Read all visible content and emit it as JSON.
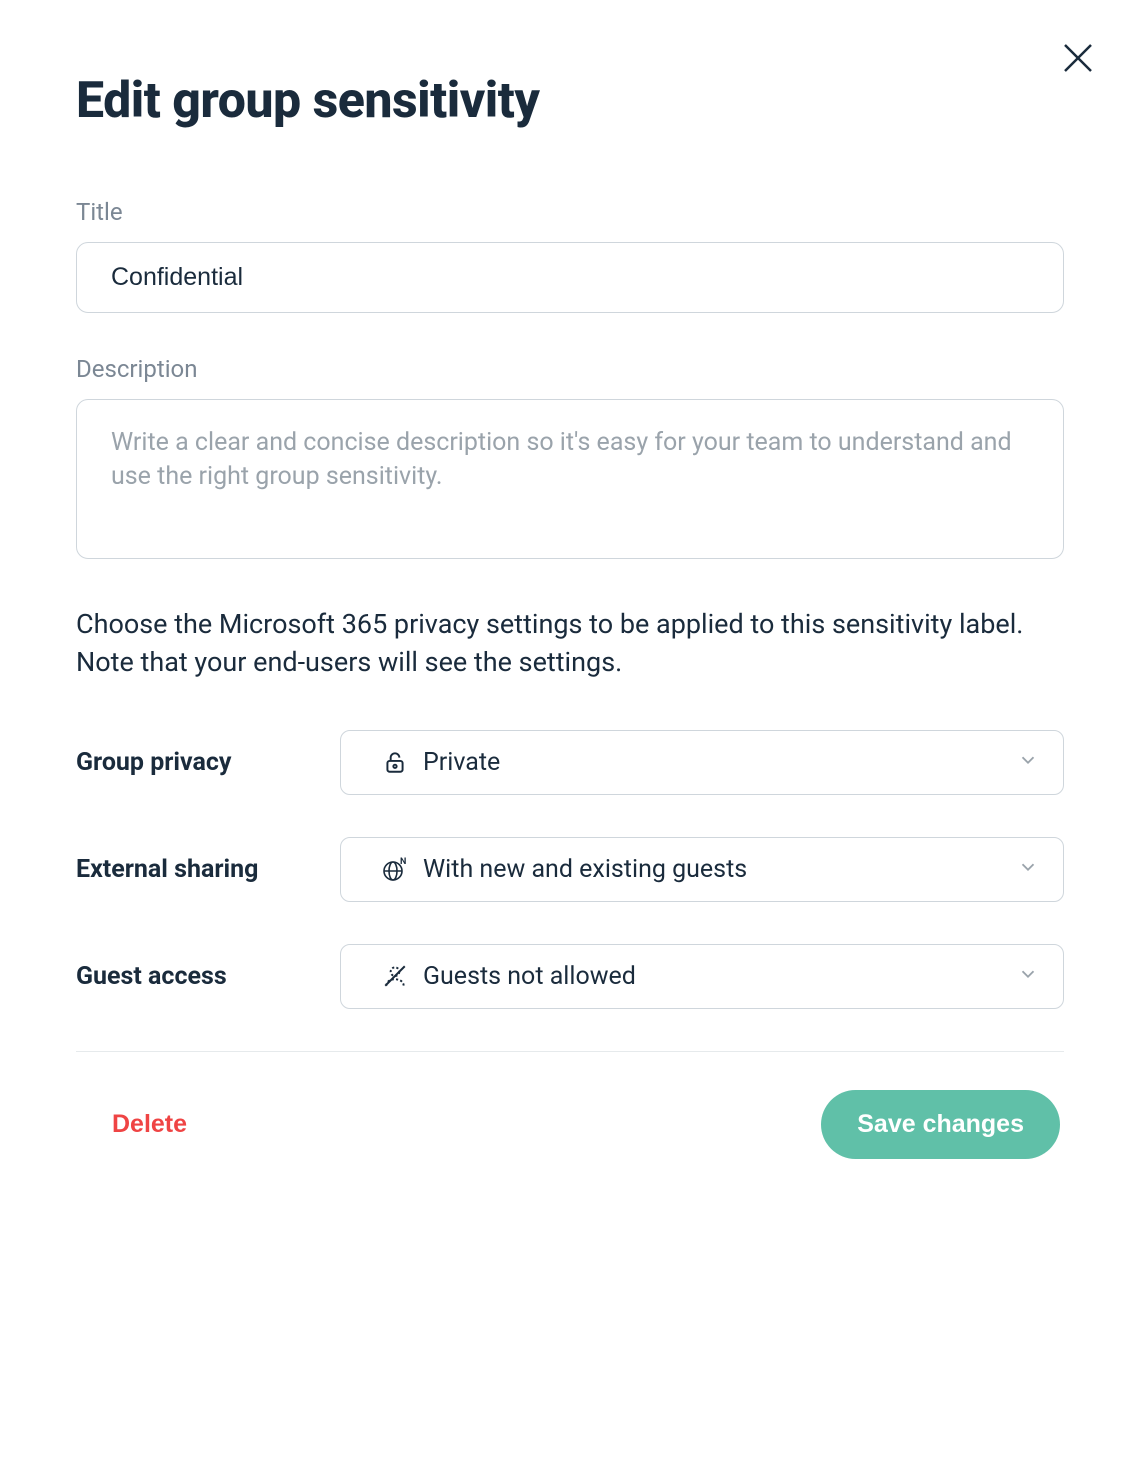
{
  "dialog": {
    "title": "Edit group sensitivity",
    "close_label": "Close"
  },
  "fields": {
    "title_label": "Title",
    "title_value": "Confidential",
    "description_label": "Description",
    "description_value": "",
    "description_placeholder": "Write a clear and concise description so it's easy for your team to understand and use the right group sensitivity."
  },
  "info": {
    "line1": "Choose the Microsoft 365 privacy settings to be applied to this sensitivity label.",
    "line2": "Note that your end-users will see the settings."
  },
  "settings": {
    "group_privacy": {
      "label": "Group privacy",
      "value": "Private",
      "icon": "lock"
    },
    "external_sharing": {
      "label": "External sharing",
      "value": "With new and existing guests",
      "icon": "globe-n"
    },
    "guest_access": {
      "label": "Guest access",
      "value": "Guests not allowed",
      "icon": "user-crossed"
    }
  },
  "footer": {
    "delete": "Delete",
    "save": "Save changes"
  }
}
